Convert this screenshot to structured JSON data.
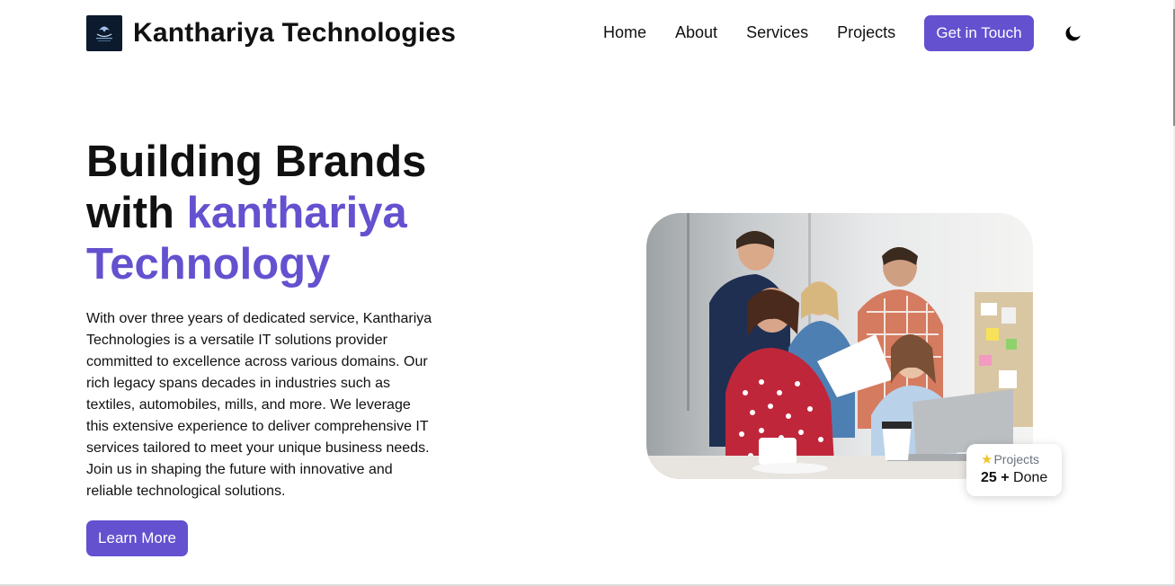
{
  "brand": {
    "name": "Kanthariya Technologies",
    "logo_icon": "company-logo-icon"
  },
  "nav": {
    "links": [
      {
        "label": "Home"
      },
      {
        "label": "About"
      },
      {
        "label": "Services"
      },
      {
        "label": "Projects"
      }
    ],
    "cta_label": "Get in Touch",
    "theme_icon": "moon-icon"
  },
  "hero": {
    "title_line1": "Building Brands",
    "title_with": "with ",
    "title_accent_1": "kanthariya",
    "title_accent_2": "Technology",
    "description": "With over three years of dedicated service, Kanthariya Technologies is a versatile IT solutions provider committed to excellence across various domains. Our rich legacy spans decades in industries such as textiles, automobiles, mills, and more. We leverage this extensive experience to deliver comprehensive IT services tailored to meet your unique business needs. Join us in shaping the future with innovative and reliable technological solutions.",
    "button_label": "Learn More"
  },
  "badge": {
    "label": "Projects",
    "count": "25 +",
    "suffix": "Done",
    "icon": "star-icon"
  },
  "colors": {
    "accent": "#6351cf",
    "text": "#111111",
    "muted": "#6b7280"
  }
}
